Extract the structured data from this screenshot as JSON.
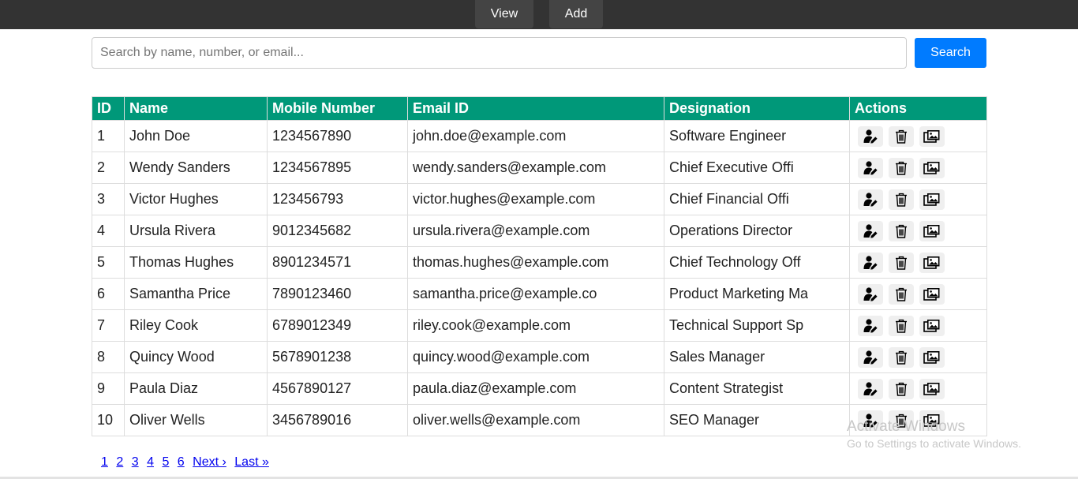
{
  "nav": {
    "view_label": "View",
    "add_label": "Add"
  },
  "search": {
    "placeholder": "Search by name, number, or email...",
    "value": "",
    "button_label": "Search"
  },
  "table": {
    "headers": [
      "ID",
      "Name",
      "Mobile Number",
      "Email ID",
      "Designation",
      "Actions"
    ],
    "rows": [
      {
        "id": "1",
        "name": "John Doe",
        "mobile": "1234567890",
        "email": "john.doe@example.com",
        "designation": "Software Engineer"
      },
      {
        "id": "2",
        "name": "Wendy Sanders",
        "mobile": "1234567895",
        "email": "wendy.sanders@example.com",
        "designation": "Chief Executive Offi"
      },
      {
        "id": "3",
        "name": "Victor Hughes",
        "mobile": "123456793",
        "email": "victor.hughes@example.com",
        "designation": "Chief Financial Offi"
      },
      {
        "id": "4",
        "name": "Ursula Rivera",
        "mobile": "9012345682",
        "email": "ursula.rivera@example.com",
        "designation": "Operations Director"
      },
      {
        "id": "5",
        "name": "Thomas Hughes",
        "mobile": "8901234571",
        "email": "thomas.hughes@example.com",
        "designation": "Chief Technology Off"
      },
      {
        "id": "6",
        "name": "Samantha Price",
        "mobile": "7890123460",
        "email": "samantha.price@example.co",
        "designation": "Product Marketing Ma"
      },
      {
        "id": "7",
        "name": "Riley Cook",
        "mobile": "6789012349",
        "email": "riley.cook@example.com",
        "designation": "Technical Support Sp"
      },
      {
        "id": "8",
        "name": "Quincy Wood",
        "mobile": "5678901238",
        "email": "quincy.wood@example.com",
        "designation": "Sales Manager"
      },
      {
        "id": "9",
        "name": "Paula Diaz",
        "mobile": "4567890127",
        "email": "paula.diaz@example.com",
        "designation": "Content Strategist"
      },
      {
        "id": "10",
        "name": "Oliver Wells",
        "mobile": "3456789016",
        "email": "oliver.wells@example.com",
        "designation": "SEO Manager"
      }
    ],
    "row_action_icons": [
      "user-edit-icon",
      "trash-icon",
      "image-icon"
    ]
  },
  "pagination": {
    "pages": [
      "1",
      "2",
      "3",
      "4",
      "5",
      "6"
    ],
    "next_label": "Next ›",
    "last_label": "Last »"
  },
  "watermark": {
    "title": "Activate Windows",
    "subtitle": "Go to Settings to activate Windows."
  },
  "colors": {
    "topbar": "#333333",
    "nav_button": "#444444",
    "header": "#009879",
    "search_button": "#007bff",
    "link": "#0000ee"
  }
}
